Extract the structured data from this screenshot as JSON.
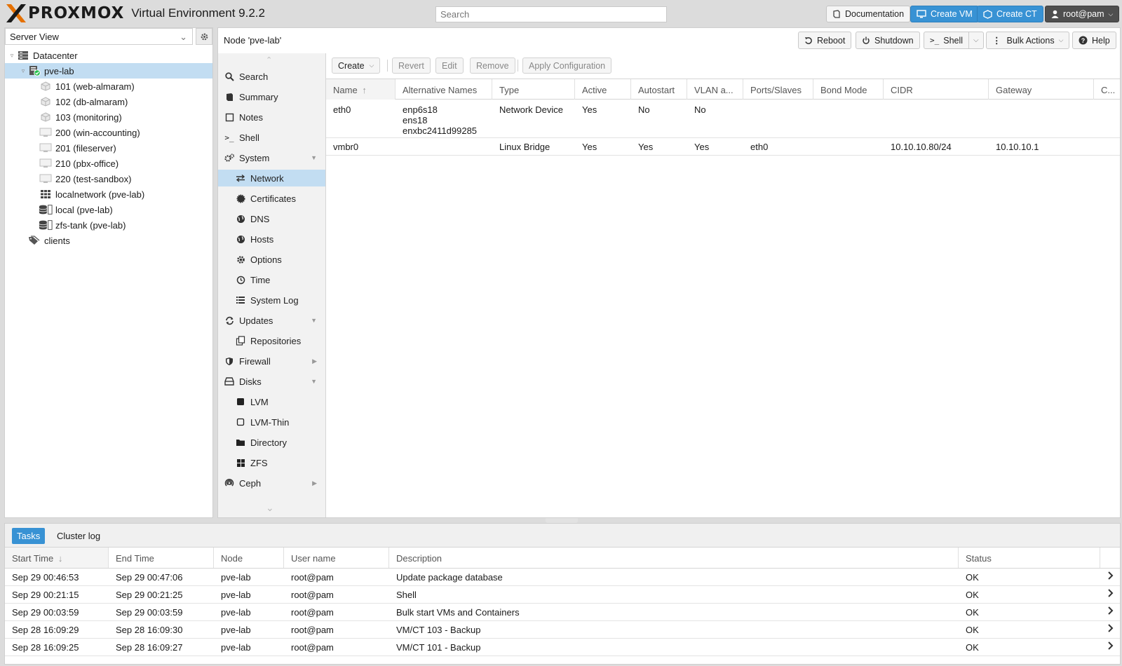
{
  "header": {
    "logo_text": "PROXMOX",
    "product": "Virtual Environment 9.2.2",
    "search_placeholder": "Search",
    "buttons": {
      "documentation": "Documentation",
      "create_vm": "Create VM",
      "create_ct": "Create CT",
      "user": "root@pam"
    }
  },
  "tree": {
    "view_label": "Server View",
    "nodes": [
      {
        "label": "Datacenter",
        "icon": "datacenter-icon"
      },
      {
        "label": "pve-lab",
        "icon": "node-online-icon"
      },
      {
        "label": "101 (web-almaram)",
        "icon": "container-icon"
      },
      {
        "label": "102 (db-almaram)",
        "icon": "container-icon"
      },
      {
        "label": "103 (monitoring)",
        "icon": "container-icon"
      },
      {
        "label": "200 (win-accounting)",
        "icon": "vm-icon"
      },
      {
        "label": "201 (fileserver)",
        "icon": "vm-icon"
      },
      {
        "label": "210 (pbx-office)",
        "icon": "vm-icon"
      },
      {
        "label": "220 (test-sandbox)",
        "icon": "vm-icon"
      },
      {
        "label": "localnetwork (pve-lab)",
        "icon": "sdn-icon"
      },
      {
        "label": "local (pve-lab)",
        "icon": "storage-icon"
      },
      {
        "label": "zfs-tank (pve-lab)",
        "icon": "storage-icon"
      },
      {
        "label": "clients",
        "icon": "tags-icon"
      }
    ]
  },
  "main": {
    "title": "Node 'pve-lab'",
    "buttons": {
      "reboot": "Reboot",
      "shutdown": "Shutdown",
      "shell": "Shell",
      "bulk_actions": "Bulk Actions",
      "help": "Help"
    }
  },
  "nav": {
    "items": [
      {
        "label": "Search",
        "icon": "search-icon"
      },
      {
        "label": "Summary",
        "icon": "book-icon"
      },
      {
        "label": "Notes",
        "icon": "notes-icon"
      },
      {
        "label": "Shell",
        "icon": "terminal-icon"
      },
      {
        "label": "System",
        "icon": "cogs-icon"
      },
      {
        "label": "Network",
        "icon": "network-icon"
      },
      {
        "label": "Certificates",
        "icon": "certificate-icon"
      },
      {
        "label": "DNS",
        "icon": "globe-icon"
      },
      {
        "label": "Hosts",
        "icon": "globe-icon"
      },
      {
        "label": "Options",
        "icon": "gear-icon"
      },
      {
        "label": "Time",
        "icon": "clock-icon"
      },
      {
        "label": "System Log",
        "icon": "list-icon"
      },
      {
        "label": "Updates",
        "icon": "refresh-icon"
      },
      {
        "label": "Repositories",
        "icon": "repository-icon"
      },
      {
        "label": "Firewall",
        "icon": "shield-icon"
      },
      {
        "label": "Disks",
        "icon": "hdd-icon"
      },
      {
        "label": "LVM",
        "icon": "square-icon"
      },
      {
        "label": "LVM-Thin",
        "icon": "square-outline-icon"
      },
      {
        "label": "Directory",
        "icon": "folder-icon"
      },
      {
        "label": "ZFS",
        "icon": "grid-icon"
      },
      {
        "label": "Ceph",
        "icon": "ceph-icon"
      }
    ]
  },
  "network": {
    "toolbar": {
      "create": "Create",
      "revert": "Revert",
      "edit": "Edit",
      "remove": "Remove",
      "apply": "Apply Configuration"
    },
    "columns": [
      "Name",
      "Alternative Names",
      "Type",
      "Active",
      "Autostart",
      "VLAN a...",
      "Ports/Slaves",
      "Bond Mode",
      "CIDR",
      "Gateway",
      "C..."
    ],
    "rows": [
      {
        "name": "eth0",
        "alt1": "enp6s18",
        "alt2": "ens18",
        "alt3": "enxbc2411d99285",
        "type": "Network Device",
        "active": "Yes",
        "autostart": "No",
        "vlan": "No",
        "ports": "",
        "bond": "",
        "cidr": "",
        "gateway": ""
      },
      {
        "name": "vmbr0",
        "alt1": "",
        "alt2": "",
        "alt3": "",
        "type": "Linux Bridge",
        "active": "Yes",
        "autostart": "Yes",
        "vlan": "Yes",
        "ports": "eth0",
        "bond": "",
        "cidr": "10.10.10.80/24",
        "gateway": "10.10.10.1"
      }
    ]
  },
  "tasks": {
    "tabs": {
      "tasks": "Tasks",
      "cluster_log": "Cluster log"
    },
    "columns": [
      "Start Time",
      "End Time",
      "Node",
      "User name",
      "Description",
      "Status"
    ],
    "rows": [
      {
        "start": "Sep 29 00:46:53",
        "end": "Sep 29 00:47:06",
        "node": "pve-lab",
        "user": "root@pam",
        "desc": "Update package database",
        "status": "OK"
      },
      {
        "start": "Sep 29 00:21:15",
        "end": "Sep 29 00:21:25",
        "node": "pve-lab",
        "user": "root@pam",
        "desc": "Shell",
        "status": "OK"
      },
      {
        "start": "Sep 29 00:03:59",
        "end": "Sep 29 00:03:59",
        "node": "pve-lab",
        "user": "root@pam",
        "desc": "Bulk start VMs and Containers",
        "status": "OK"
      },
      {
        "start": "Sep 28 16:09:29",
        "end": "Sep 28 16:09:30",
        "node": "pve-lab",
        "user": "root@pam",
        "desc": "VM/CT 103 - Backup",
        "status": "OK"
      },
      {
        "start": "Sep 28 16:09:25",
        "end": "Sep 28 16:09:27",
        "node": "pve-lab",
        "user": "root@pam",
        "desc": "VM/CT 101 - Backup",
        "status": "OK"
      }
    ]
  },
  "colors": {
    "accent": "#3892d4",
    "selection": "#c2ddf2",
    "logo_orange": "#e57000",
    "online_green": "#21bf4b"
  }
}
